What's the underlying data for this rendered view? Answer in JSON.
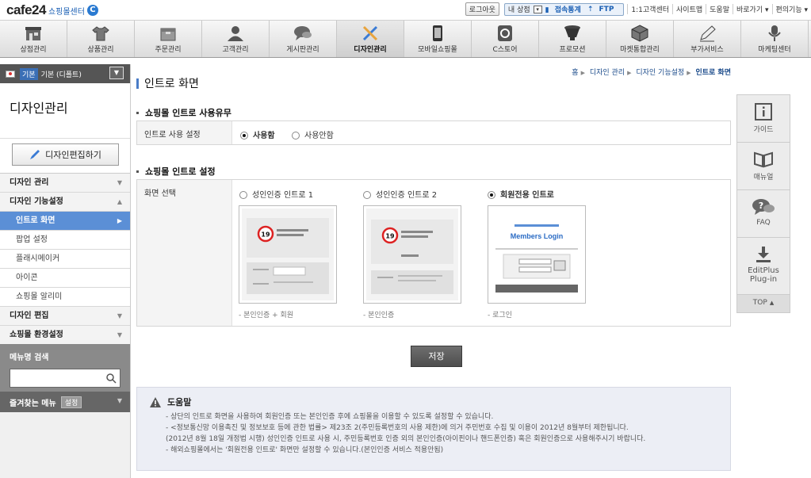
{
  "header": {
    "logo": "cafe24",
    "logo_sub": "쇼핑몰센터",
    "logo_c": "C",
    "logout": "로그아웃",
    "mystore_label": "내 상점",
    "stats": "접속통계",
    "ftp": "FTP",
    "links": [
      "1:1고객센터",
      "사이트맵",
      "도움말",
      "바로가기 ▾",
      "편의기능 ▾"
    ]
  },
  "nav": [
    {
      "label": "상점관리",
      "icon": "store-icon"
    },
    {
      "label": "상품관리",
      "icon": "shirt-icon"
    },
    {
      "label": "주문관리",
      "icon": "box-icon"
    },
    {
      "label": "고객관리",
      "icon": "person-icon"
    },
    {
      "label": "게시판관리",
      "icon": "chat-icon"
    },
    {
      "label": "디자인관리",
      "icon": "tools-icon"
    },
    {
      "label": "모바일쇼핑몰",
      "icon": "mobile-icon"
    },
    {
      "label": "C스토어",
      "icon": "cstore-icon"
    },
    {
      "label": "프로모션",
      "icon": "cup-icon"
    },
    {
      "label": "마켓통합관리",
      "icon": "cube-icon"
    },
    {
      "label": "부가서비스",
      "icon": "pencil-icon"
    },
    {
      "label": "마케팅센터",
      "icon": "mic-icon"
    }
  ],
  "sidebar": {
    "lang_tag": "기본",
    "lang_label": "기본 (디폴트)",
    "title": "디자인관리",
    "edit_button": "디자인편집하기",
    "menu": [
      {
        "label": "디자인 관리",
        "type": "group"
      },
      {
        "label": "디자인 기능설정",
        "type": "group"
      },
      {
        "label": "인트로 화면",
        "type": "sub"
      },
      {
        "label": "팝업 설정",
        "type": "sub"
      },
      {
        "label": "플래시메이커",
        "type": "sub"
      },
      {
        "label": "아이콘",
        "type": "sub"
      },
      {
        "label": "쇼핑몰 알리미",
        "type": "sub"
      },
      {
        "label": "디자인 편집",
        "type": "group"
      },
      {
        "label": "쇼핑몰 환경설정",
        "type": "group"
      }
    ],
    "search_label": "메뉴명 검색",
    "fav_label": "즐겨찾는 메뉴",
    "fav_settings": "설정"
  },
  "content": {
    "breadcrumb": [
      "홈",
      "디자인 관리",
      "디자인 기능설정",
      "인트로 화면"
    ],
    "page_title": "인트로 화면",
    "section1_title": "쇼핑몰 인트로 사용유무",
    "use_label": "인트로 사용 설정",
    "use_options": [
      "사용함",
      "사용안함"
    ],
    "use_selected": "사용함",
    "section2_title": "쇼핑몰 인트로 설정",
    "screen_label": "화면 선택",
    "screen_options": [
      {
        "label": "성인인증 인트로 1",
        "caption": "- 본인인증 + 회원"
      },
      {
        "label": "성인인증 인트로 2",
        "caption": "- 본인인증"
      },
      {
        "label": "회원전용 인트로",
        "caption": "- 로그인"
      }
    ],
    "screen_selected": "회원전용 인트로",
    "members_login": "Members Login",
    "save": "저장",
    "help_title": "도움말",
    "help_lines": [
      "- 상단의 인트로 화면을 사용하여 회원인증 또는 본인인증 후에 쇼핑몰을 이용할 수 있도록 설정할 수 있습니다.",
      "- <정보통신망 이용촉진 및 정보보호 등에 관한 법률> 제23조 2(주민등록번호의 사용 제한)에 의거 주민번호 수집 및 이용이 2012년 8월부터 제한됩니다.",
      "  (2012년 8월 18일 개정법 시행) 성인인증 인트로 사용 시, 주민등록번호 인증 외의 본인인증(아이핀이나 핸드폰인증) 혹은 회원인증으로 사용해주시기 바랍니다.",
      "- 해외쇼핑몰에서는 '회원전용 인트로' 화면만 설정할 수 있습니다.(본인인증 서비스 적용안됨)"
    ]
  },
  "right_panel": {
    "guide": "가이드",
    "manual": "매뉴얼",
    "faq": "FAQ",
    "editplus": "EditPlus Plug-in",
    "top": "TOP"
  }
}
